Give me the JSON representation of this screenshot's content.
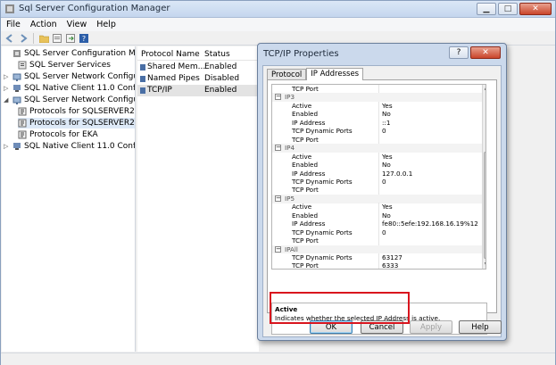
{
  "window": {
    "title": "Sql Server Configuration Manager"
  },
  "menu": [
    "File",
    "Action",
    "View",
    "Help"
  ],
  "tree": {
    "items": [
      {
        "label": "SQL Server Configuration Manager",
        "level": 0,
        "icon": "config-manager-icon"
      },
      {
        "label": "SQL Server Services",
        "level": 1,
        "icon": "services-icon"
      },
      {
        "label": "SQL Server Network Configuratic",
        "level": 1,
        "icon": "network-icon",
        "arrow": "▷"
      },
      {
        "label": "SQL Native Client 11.0 Configura",
        "level": 1,
        "icon": "client-icon",
        "arrow": "▷"
      },
      {
        "label": "SQL Server Network Configuratic",
        "level": 1,
        "icon": "network-icon",
        "arrow": "◢"
      },
      {
        "label": "Protocols for SQLSERVER2014",
        "level": 2,
        "icon": "protocol-icon"
      },
      {
        "label": "Protocols for SQLSERVER2012",
        "level": 2,
        "icon": "protocol-icon",
        "selected": true
      },
      {
        "label": "Protocols for EKA",
        "level": 2,
        "icon": "protocol-icon"
      },
      {
        "label": "SQL Native Client 11.0 Configura",
        "level": 1,
        "icon": "client-icon",
        "arrow": "▷"
      }
    ]
  },
  "list": {
    "headers": {
      "name": "Protocol Name",
      "status": "Status"
    },
    "rows": [
      {
        "name": "Shared Mem...",
        "status": "Enabled"
      },
      {
        "name": "Named Pipes",
        "status": "Disabled"
      },
      {
        "name": "TCP/IP",
        "status": "Enabled",
        "selected": true
      }
    ]
  },
  "dialog": {
    "title": "TCP/IP Properties",
    "help_label": "?",
    "tabs": [
      "Protocol",
      "IP Addresses"
    ],
    "grid": [
      {
        "type": "prop",
        "key": "TCP Port",
        "value": ""
      },
      {
        "type": "cat",
        "key": "IP3"
      },
      {
        "type": "prop",
        "key": "Active",
        "value": "Yes"
      },
      {
        "type": "prop",
        "key": "Enabled",
        "value": "No"
      },
      {
        "type": "prop",
        "key": "IP Address",
        "value": "::1"
      },
      {
        "type": "prop",
        "key": "TCP Dynamic Ports",
        "value": "0"
      },
      {
        "type": "prop",
        "key": "TCP Port",
        "value": ""
      },
      {
        "type": "cat",
        "key": "IP4"
      },
      {
        "type": "prop",
        "key": "Active",
        "value": "Yes"
      },
      {
        "type": "prop",
        "key": "Enabled",
        "value": "No"
      },
      {
        "type": "prop",
        "key": "IP Address",
        "value": "127.0.0.1"
      },
      {
        "type": "prop",
        "key": "TCP Dynamic Ports",
        "value": "0"
      },
      {
        "type": "prop",
        "key": "TCP Port",
        "value": ""
      },
      {
        "type": "cat",
        "key": "IP5"
      },
      {
        "type": "prop",
        "key": "Active",
        "value": "Yes"
      },
      {
        "type": "prop",
        "key": "Enabled",
        "value": "No"
      },
      {
        "type": "prop",
        "key": "IP Address",
        "value": "fe80::5efe:192.168.16.19%12"
      },
      {
        "type": "prop",
        "key": "TCP Dynamic Ports",
        "value": "0"
      },
      {
        "type": "prop",
        "key": "TCP Port",
        "value": ""
      },
      {
        "type": "cat",
        "key": "IPAll"
      },
      {
        "type": "prop",
        "key": "TCP Dynamic Ports",
        "value": "63127"
      },
      {
        "type": "prop",
        "key": "TCP Port",
        "value": "6333"
      }
    ],
    "description": {
      "title": "Active",
      "text": "Indicates whether the selected IP Address is active."
    },
    "buttons": {
      "ok": "OK",
      "cancel": "Cancel",
      "apply": "Apply",
      "help": "Help"
    }
  },
  "colors": {
    "highlight": "#d9151e",
    "titlebar": "#c4d6ee"
  }
}
